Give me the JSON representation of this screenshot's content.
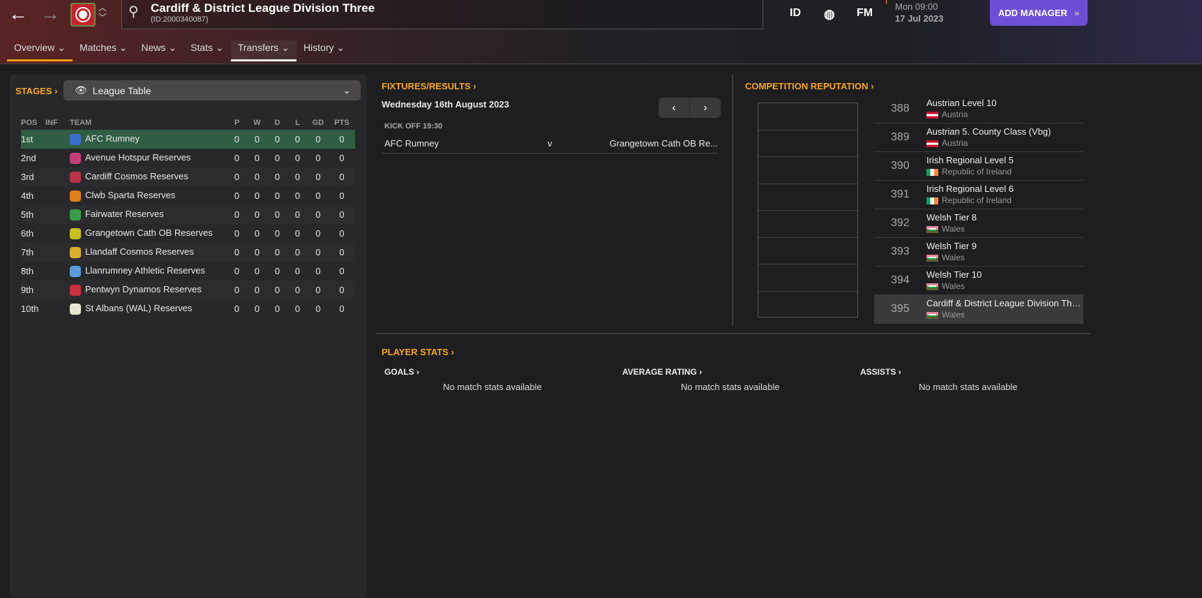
{
  "header": {
    "title": "Cardiff & District League Division Three",
    "id": "(ID:2000340087)",
    "icons": [
      "ID",
      "globe-icon",
      "FM"
    ],
    "day_time": "Mon 09:00",
    "date": "17 Jul 2023",
    "add_manager": "ADD MANAGER"
  },
  "tabs": [
    {
      "label": "Overview"
    },
    {
      "label": "Matches"
    },
    {
      "label": "News"
    },
    {
      "label": "Stats"
    },
    {
      "label": "Transfers"
    },
    {
      "label": "History"
    }
  ],
  "stages": {
    "label": "STAGES",
    "selected": "League Table"
  },
  "table": {
    "headers": [
      "POS",
      "INF",
      "TEAM",
      "P",
      "W",
      "D",
      "L",
      "GD",
      "PTS"
    ],
    "rows": [
      {
        "pos": "1st",
        "team": "AFC Rumney",
        "color": "#3a6fc9",
        "p": "0",
        "w": "0",
        "d": "0",
        "l": "0",
        "gd": "0",
        "pts": "0"
      },
      {
        "pos": "2nd",
        "team": "Avenue Hotspur Reserves",
        "color": "#c2407a",
        "p": "0",
        "w": "0",
        "d": "0",
        "l": "0",
        "gd": "0",
        "pts": "0"
      },
      {
        "pos": "3rd",
        "team": "Cardiff Cosmos Reserves",
        "color": "#b8324a",
        "p": "0",
        "w": "0",
        "d": "0",
        "l": "0",
        "gd": "0",
        "pts": "0"
      },
      {
        "pos": "4th",
        "team": "Clwb Sparta Reserves",
        "color": "#e0801c",
        "p": "0",
        "w": "0",
        "d": "0",
        "l": "0",
        "gd": "0",
        "pts": "0"
      },
      {
        "pos": "5th",
        "team": "Fairwater Reserves",
        "color": "#3a9a4a",
        "p": "0",
        "w": "0",
        "d": "0",
        "l": "0",
        "gd": "0",
        "pts": "0"
      },
      {
        "pos": "6th",
        "team": "Grangetown Cath OB Reserves",
        "color": "#c8c020",
        "p": "0",
        "w": "0",
        "d": "0",
        "l": "0",
        "gd": "0",
        "pts": "0"
      },
      {
        "pos": "7th",
        "team": "Llandaff Cosmos Reserves",
        "color": "#d8b030",
        "p": "0",
        "w": "0",
        "d": "0",
        "l": "0",
        "gd": "0",
        "pts": "0"
      },
      {
        "pos": "8th",
        "team": "Llanrumney Athletic Reserves",
        "color": "#5a9ad8",
        "p": "0",
        "w": "0",
        "d": "0",
        "l": "0",
        "gd": "0",
        "pts": "0"
      },
      {
        "pos": "9th",
        "team": "Pentwyn Dynamos Reserves",
        "color": "#c83040",
        "p": "0",
        "w": "0",
        "d": "0",
        "l": "0",
        "gd": "0",
        "pts": "0"
      },
      {
        "pos": "10th",
        "team": "St Albans (WAL) Reserves",
        "color": "#e8e8d0",
        "p": "0",
        "w": "0",
        "d": "0",
        "l": "0",
        "gd": "0",
        "pts": "0"
      }
    ]
  },
  "fixtures": {
    "label": "FIXTURES/RESULTS",
    "date": "Wednesday 16th August 2023",
    "kickoff": "KICK OFF 19:30",
    "home": "AFC Rumney",
    "vs": "v",
    "away": "Grangetown Cath OB Re..."
  },
  "reputation": {
    "label": "COMPETITION REPUTATION",
    "rows": [
      {
        "rank": "388",
        "name": "Austrian Level 10",
        "nation": "Austria",
        "flag": "at"
      },
      {
        "rank": "389",
        "name": "Austrian 5. County Class (Vbg)",
        "nation": "Austria",
        "flag": "at"
      },
      {
        "rank": "390",
        "name": "Irish Regional Level 5",
        "nation": "Republic of Ireland",
        "flag": "ie"
      },
      {
        "rank": "391",
        "name": "Irish Regional Level 6",
        "nation": "Republic of Ireland",
        "flag": "ie"
      },
      {
        "rank": "392",
        "name": "Welsh Tier 8",
        "nation": "Wales",
        "flag": "wa"
      },
      {
        "rank": "393",
        "name": "Welsh Tier 9",
        "nation": "Wales",
        "flag": "wa"
      },
      {
        "rank": "394",
        "name": "Welsh Tier 10",
        "nation": "Wales",
        "flag": "wa"
      },
      {
        "rank": "395",
        "name": "Cardiff & District League Division Three",
        "nation": "Wales",
        "flag": "wa"
      }
    ]
  },
  "player_stats": {
    "label": "PLAYER STATS",
    "sections": [
      {
        "label": "GOALS",
        "empty": "No match stats available"
      },
      {
        "label": "AVERAGE RATING",
        "empty": "No match stats available"
      },
      {
        "label": "ASSISTS",
        "empty": "No match stats available"
      }
    ]
  }
}
